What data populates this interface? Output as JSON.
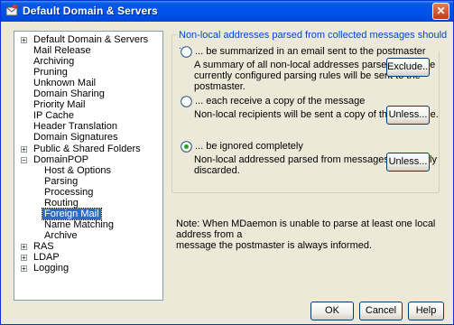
{
  "window": {
    "title": "Default Domain & Servers",
    "close_glyph": "✕"
  },
  "tree": {
    "items": [
      {
        "label": "Default Domain & Servers",
        "expander": "+"
      },
      {
        "label": "Mail Release"
      },
      {
        "label": "Archiving"
      },
      {
        "label": "Pruning"
      },
      {
        "label": "Unknown Mail"
      },
      {
        "label": "Domain Sharing"
      },
      {
        "label": "Priority Mail"
      },
      {
        "label": "IP Cache"
      },
      {
        "label": "Header Translation"
      },
      {
        "label": "Domain Signatures"
      },
      {
        "label": "Public & Shared Folders",
        "expander": "+"
      },
      {
        "label": "DomainPOP",
        "expander": "−"
      },
      {
        "label": "Host & Options"
      },
      {
        "label": "Parsing"
      },
      {
        "label": "Processing"
      },
      {
        "label": "Routing"
      },
      {
        "label": "Foreign Mail",
        "selected": true
      },
      {
        "label": "Name Matching"
      },
      {
        "label": "Archive"
      },
      {
        "label": "RAS",
        "expander": "+"
      },
      {
        "label": "LDAP",
        "expander": "+"
      },
      {
        "label": "Logging",
        "expander": "+"
      }
    ]
  },
  "group": {
    "title": "Non-local addresses parsed from collected messages should ..."
  },
  "options": [
    {
      "label": "... be summarized in an email sent to the postmaster",
      "checked": false,
      "description": [
        "A summary of all non-local addresses parsed using the",
        "currently configured parsing rules will be sent to the",
        "postmaster."
      ],
      "button": "Exclude..."
    },
    {
      "label": "... each receive a copy of the message",
      "checked": false,
      "description": [
        "Non-local recipients will be sent a copy of the message."
      ],
      "button": "Unless..."
    },
    {
      "label": "... be ignored completely",
      "checked": true,
      "description": [
        "Non-local addressed parsed from messages are simply",
        "discarded."
      ],
      "button": "Unless..."
    }
  ],
  "note": {
    "line1": "Note:  When MDaemon is unable to parse at least one local address from a",
    "line2": "message the postmaster is always informed."
  },
  "footer": {
    "ok": "OK",
    "cancel": "Cancel",
    "help": "Help"
  },
  "colors": {
    "titlebar": "#0053ee",
    "group_title": "#0046d5",
    "selection": "#316ac5",
    "face": "#ece9d8"
  }
}
